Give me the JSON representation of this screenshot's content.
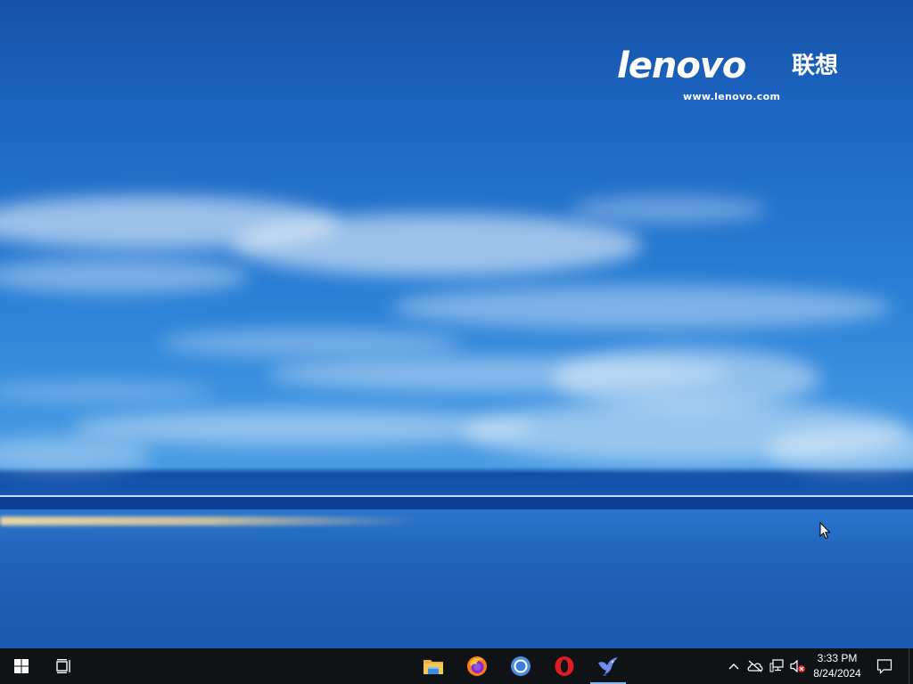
{
  "wallpaper": {
    "brand": "lenovo",
    "brand_chinese": "联想",
    "url": "www.lenovo.com"
  },
  "taskbar": {
    "start_icon": "windows-start-icon",
    "task_view_icon": "task-view-icon",
    "pinned_apps": [
      {
        "name": "File Explorer",
        "icon": "folder-icon"
      },
      {
        "name": "Firefox",
        "icon": "firefox-icon"
      },
      {
        "name": "Chrome",
        "icon": "chrome-icon"
      },
      {
        "name": "Opera",
        "icon": "opera-icon"
      },
      {
        "name": "Bird app",
        "icon": "bird-icon",
        "active": true
      }
    ],
    "tray": {
      "icons": [
        "chevron-up-icon",
        "onedrive-icon",
        "network-icon",
        "volume-muted-icon"
      ],
      "time": "3:33 PM",
      "date": "8/24/2024"
    },
    "notifications_icon": "action-center-icon"
  },
  "colors": {
    "taskbar_bg": "#101316",
    "active_indicator": "#7fb8ee",
    "sky_top": "#1552a8",
    "sea": "#1f62b8"
  }
}
